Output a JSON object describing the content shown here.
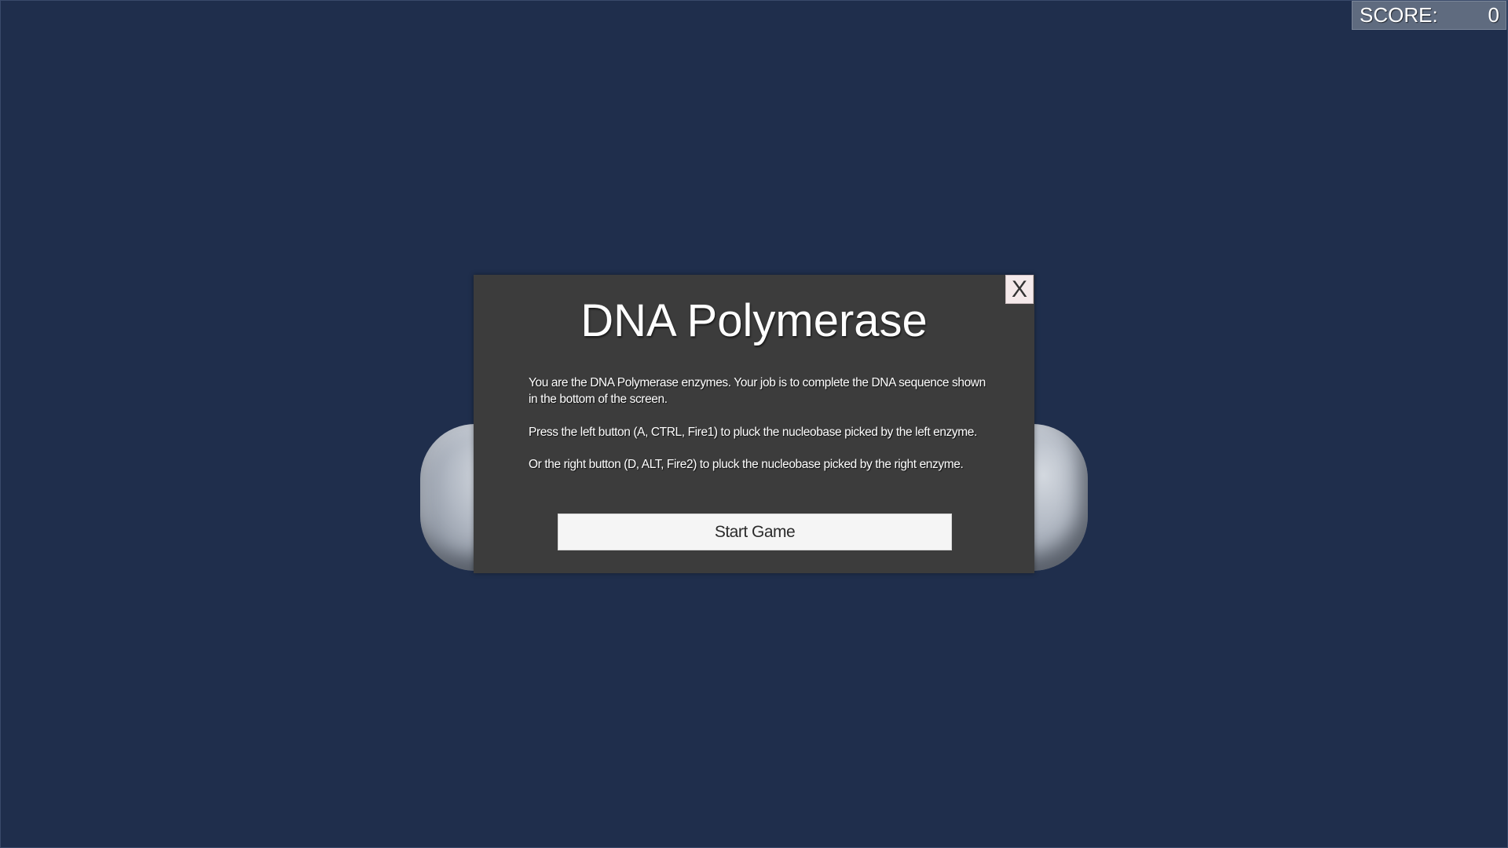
{
  "hud": {
    "score_label": "SCORE:",
    "score_value": "0"
  },
  "modal": {
    "title": "DNA Polymerase",
    "close_label": "X",
    "paragraphs": [
      "You are the DNA Polymerase enzymes. Your job is to complete the DNA sequence shown in the bottom of the screen.",
      "Press the left button (A, CTRL, Fire1) to pluck the nucleobase picked by the left enzyme.",
      "Or the right button (D, ALT, Fire2) to pluck the nucleobase picked by the right enzyme."
    ],
    "start_label": "Start Game"
  },
  "colors": {
    "background": "#1f2e4c",
    "modal_background": "#3c3c3c",
    "score_background": "#5f6b7f",
    "enzyme": "#b1b8c3",
    "close_button": "#f4e9ea",
    "start_button": "#f5f5f5"
  }
}
